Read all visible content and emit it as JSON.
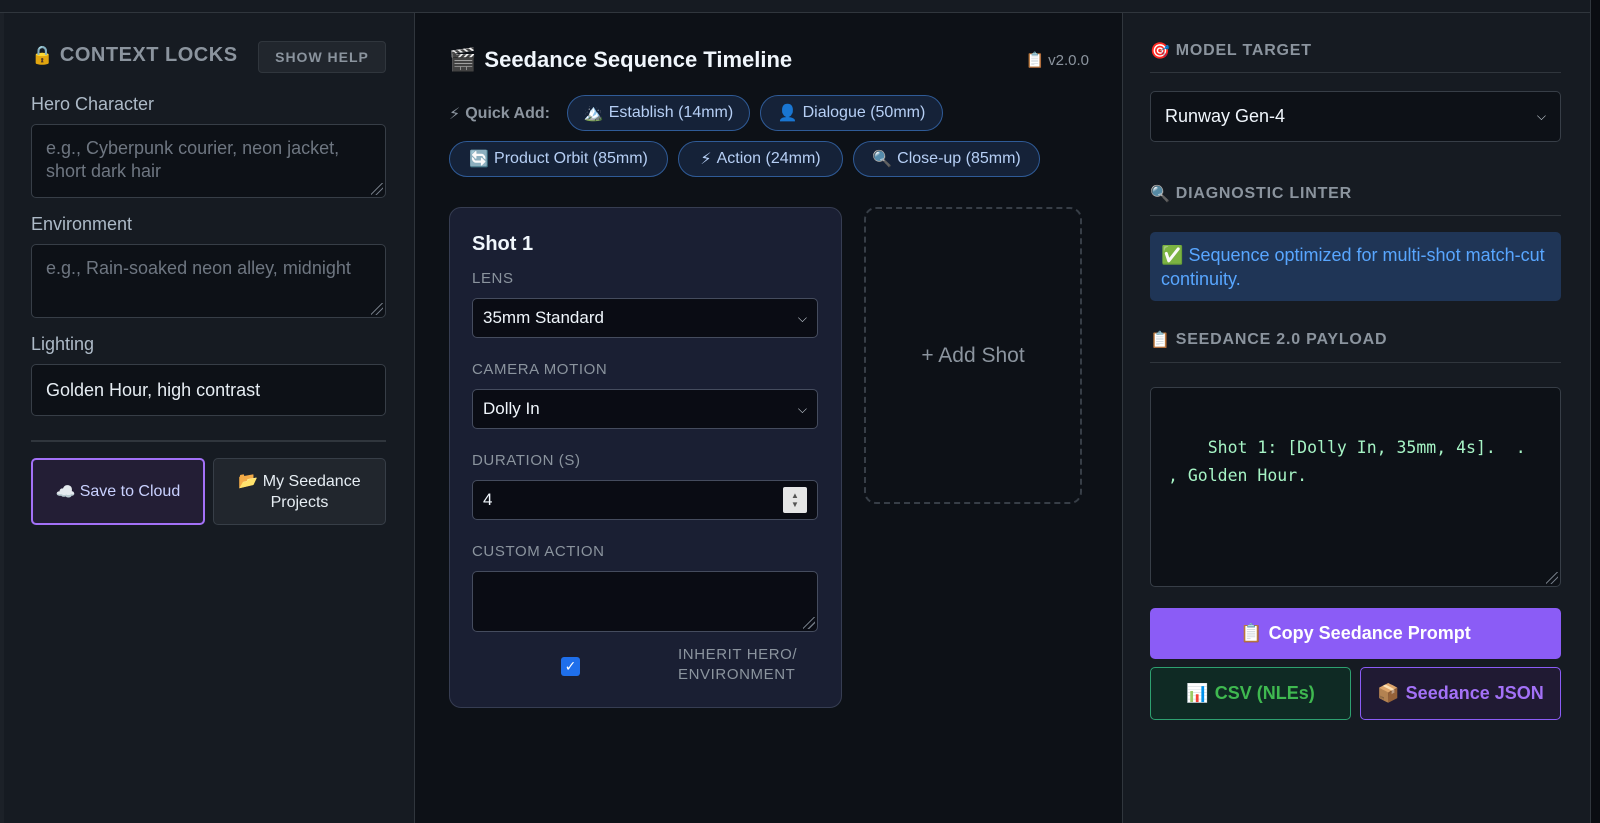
{
  "context_locks": {
    "icon": "🔒",
    "title": "CONTEXT LOCKS",
    "help_label": "SHOW HELP",
    "hero": {
      "label": "Hero Character",
      "placeholder": "e.g., Cyberpunk courier, neon jacket, short dark hair",
      "value": ""
    },
    "environment": {
      "label": "Environment",
      "placeholder": "e.g., Rain-soaked neon alley, midnight",
      "value": ""
    },
    "lighting": {
      "label": "Lighting",
      "value": "Golden Hour, high contrast"
    },
    "save_icon": "☁️",
    "save_label": "Save to Cloud",
    "projects_icon": "📂",
    "projects_label": "My Seedance Projects"
  },
  "timeline": {
    "icon": "🎬",
    "title": "Seedance Sequence Timeline",
    "version_icon": "📋",
    "version": "v2.0.0",
    "quick_add_icon": "⚡",
    "quick_add_label": "Quick Add:",
    "presets": [
      {
        "icon": "🏔️",
        "label": "Establish (14mm)"
      },
      {
        "icon": "👤",
        "label": "Dialogue (50mm)"
      },
      {
        "icon": "🔄",
        "label": "Product Orbit (85mm)"
      },
      {
        "icon": "⚡",
        "label": "Action (24mm)"
      },
      {
        "icon": "🔍",
        "label": "Close-up (85mm)"
      }
    ],
    "shot": {
      "title": "Shot 1",
      "lens_label": "LENS",
      "lens_value": "35mm Standard",
      "motion_label": "CAMERA MOTION",
      "motion_value": "Dolly In",
      "duration_label": "DURATION (S)",
      "duration_value": "4",
      "action_label": "CUSTOM ACTION",
      "action_value": "",
      "inherit_label": "INHERIT HERO/ ENVIRONMENT",
      "inherit_checked": true
    },
    "add_shot_label": "+ Add Shot"
  },
  "right": {
    "model_icon": "🎯",
    "model_title": "MODEL TARGET",
    "model_value": "Runway Gen-4",
    "linter_icon": "🔍",
    "linter_title": "DIAGNOSTIC LINTER",
    "linter_icon_ok": "✅",
    "linter_message": "Sequence optimized for multi-shot match-cut continuity.",
    "payload_icon": "📋",
    "payload_title": "SEEDANCE 2.0 PAYLOAD",
    "payload_text": "Shot 1: [Dolly In, 35mm, 4s].  . , Golden Hour.",
    "copy_icon": "📋",
    "copy_label": "Copy Seedance Prompt",
    "csv_icon": "📊",
    "csv_label": "CSV (NLEs)",
    "json_icon": "📦",
    "json_label": "Seedance JSON"
  }
}
